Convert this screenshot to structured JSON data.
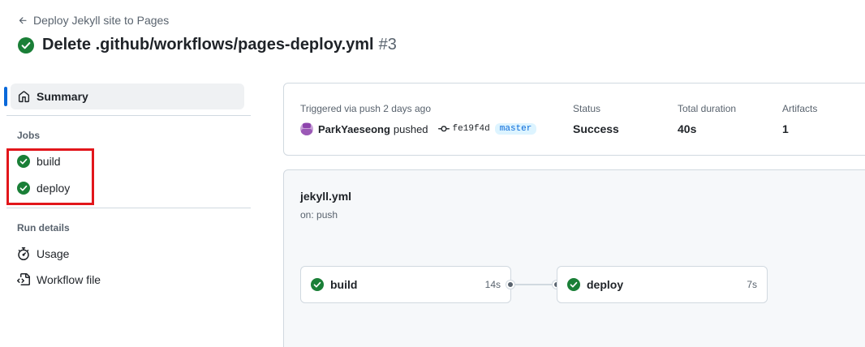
{
  "header": {
    "back_link": "Deploy Jekyll site to Pages",
    "title": "Delete .github/workflows/pages-deploy.yml",
    "run_number": "#3"
  },
  "sidebar": {
    "summary_label": "Summary",
    "jobs_heading": "Jobs",
    "jobs": [
      {
        "label": "build",
        "status": "success"
      },
      {
        "label": "deploy",
        "status": "success"
      }
    ],
    "run_details_heading": "Run details",
    "run_details": [
      {
        "label": "Usage",
        "icon": "stopwatch-icon"
      },
      {
        "label": "Workflow file",
        "icon": "file-code-icon"
      }
    ]
  },
  "run_summary": {
    "trigger_text": "Triggered via push 2 days ago",
    "actor": "ParkYaeseong",
    "action": "pushed",
    "commit_sha": "fe19f4d",
    "branch": "master",
    "status_label": "Status",
    "status_value": "Success",
    "duration_label": "Total duration",
    "duration_value": "40s",
    "artifacts_label": "Artifacts",
    "artifacts_value": "1"
  },
  "workflow_graph": {
    "file_name": "jekyll.yml",
    "trigger": "on: push",
    "jobs": [
      {
        "name": "build",
        "duration": "14s",
        "status": "success"
      },
      {
        "name": "deploy",
        "duration": "7s",
        "status": "success"
      }
    ]
  },
  "colors": {
    "success": "#1a7f37",
    "accent": "#0969da",
    "highlight": "#e2161b"
  }
}
